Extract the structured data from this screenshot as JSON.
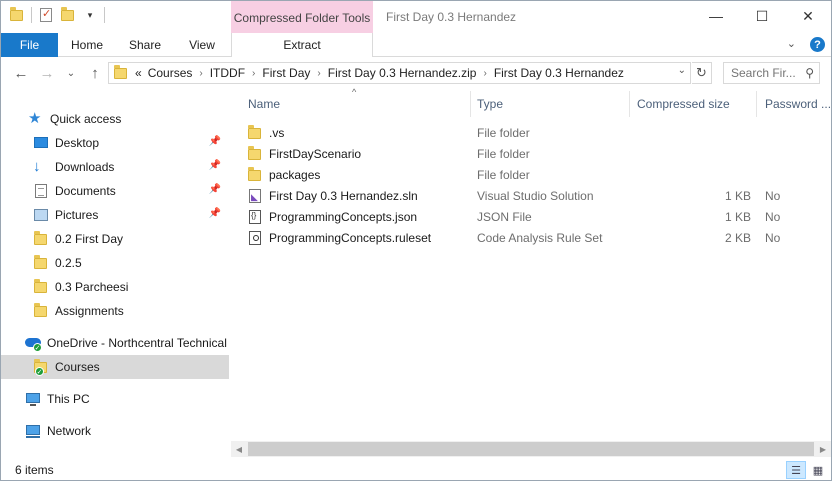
{
  "window": {
    "title": "First Day 0.3 Hernandez",
    "contextual_tab_group": "Compressed Folder Tools",
    "controls": {
      "minimize": "—",
      "maximize": "☐",
      "close": "✕"
    }
  },
  "quick_access_toolbar": {
    "icons": [
      "folder-icon",
      "properties-icon",
      "new-folder-icon",
      "customize-dropdown-icon"
    ]
  },
  "ribbon": {
    "tabs": [
      "File",
      "Home",
      "Share",
      "View"
    ],
    "contextual_tab": "Extract",
    "collapse_glyph": "⌄",
    "help_glyph": "?"
  },
  "navigation": {
    "back_glyph": "←",
    "forward_glyph": "→",
    "recent_glyph": "⌄",
    "up_glyph": "↑",
    "overflow_glyph": "«",
    "breadcrumbs": [
      "Courses",
      "ITDDF",
      "First Day",
      "First Day 0.3 Hernandez.zip",
      "First Day 0.3 Hernandez"
    ],
    "separator_glyph": "›",
    "dropdown_glyph": "⌄",
    "refresh_glyph": "↻",
    "search_placeholder": "Search Fir...",
    "search_glyph": "⚲"
  },
  "nav_pane": {
    "quick_access": {
      "label": "Quick access",
      "icon": "star-icon"
    },
    "pinned": [
      {
        "label": "Desktop",
        "icon": "desktop-icon",
        "pinned": true
      },
      {
        "label": "Downloads",
        "icon": "download-icon",
        "pinned": true
      },
      {
        "label": "Documents",
        "icon": "documents-icon",
        "pinned": true
      },
      {
        "label": "Pictures",
        "icon": "pictures-icon",
        "pinned": true
      },
      {
        "label": "0.2 First Day",
        "icon": "folder-icon",
        "pinned": false
      },
      {
        "label": "0.2.5",
        "icon": "folder-icon",
        "pinned": false
      },
      {
        "label": "0.3 Parcheesi",
        "icon": "folder-icon",
        "pinned": false
      },
      {
        "label": "Assignments",
        "icon": "folder-icon",
        "pinned": false
      }
    ],
    "pin_glyph": "📌",
    "onedrive": "OneDrive - Northcentral Technical",
    "courses": "Courses",
    "this_pc": "This PC",
    "network": "Network"
  },
  "columns": [
    "Name",
    "Type",
    "Compressed size",
    "Password ..."
  ],
  "sort_glyph": "^",
  "files": [
    {
      "name": ".vs",
      "type": "File folder",
      "size": "",
      "password": "",
      "icon": "folder-icon"
    },
    {
      "name": "FirstDayScenario",
      "type": "File folder",
      "size": "",
      "password": "",
      "icon": "folder-icon"
    },
    {
      "name": "packages",
      "type": "File folder",
      "size": "",
      "password": "",
      "icon": "folder-icon"
    },
    {
      "name": "First Day 0.3 Hernandez.sln",
      "type": "Visual Studio Solution",
      "size": "1 KB",
      "password": "No",
      "icon": "vs-solution-icon"
    },
    {
      "name": "ProgrammingConcepts.json",
      "type": "JSON File",
      "size": "1 KB",
      "password": "No",
      "icon": "json-file-icon"
    },
    {
      "name": "ProgrammingConcepts.ruleset",
      "type": "Code Analysis Rule Set",
      "size": "2 KB",
      "password": "No",
      "icon": "ruleset-file-icon"
    }
  ],
  "scrollbar": {
    "left_glyph": "◀",
    "right_glyph": "▶"
  },
  "status": {
    "item_count": "6 items",
    "details_view_glyph": "☰",
    "large_icons_view_glyph": "▦"
  },
  "colors": {
    "accent": "#1979ca",
    "contextual_tab": "#f7cfe3",
    "folder": "#f5d76e",
    "selected_nav": "#d9d9d9",
    "column_header_text": "#4c607a"
  }
}
